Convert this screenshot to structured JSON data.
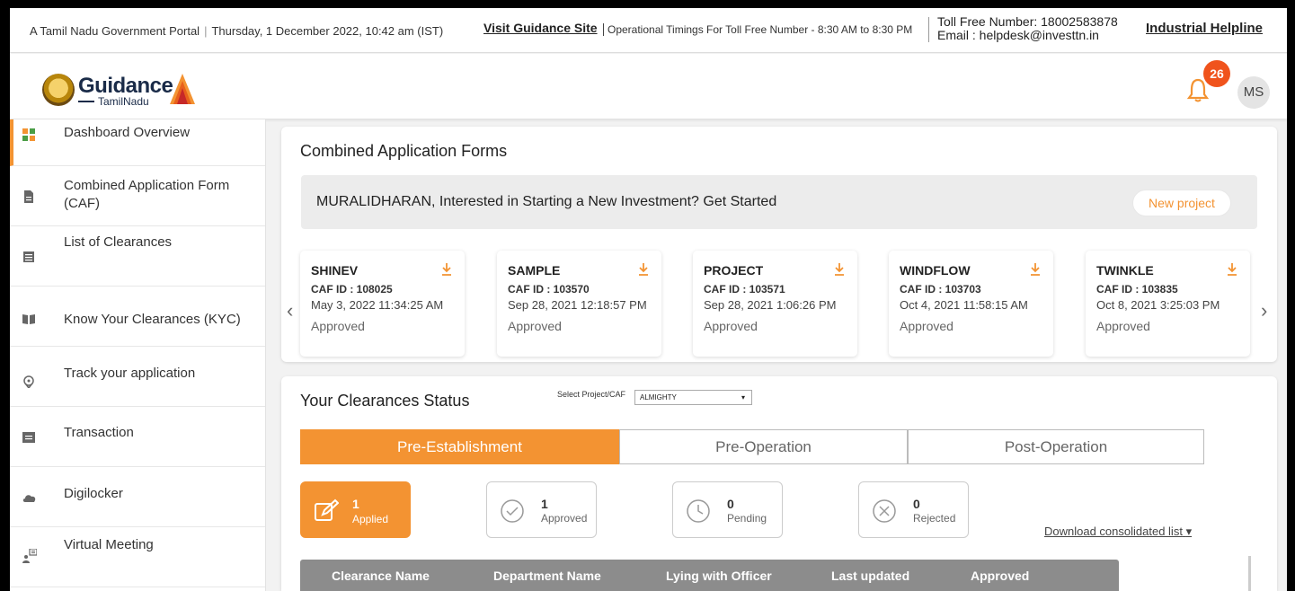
{
  "topbar": {
    "portal": "A Tamil Nadu Government Portal",
    "datetime": "Thursday, 1 December 2022, 10:42 am (IST)",
    "visit_link": "Visit Guidance Site",
    "timings": "Operational Timings For Toll Free Number - 8:30 AM to 8:30 PM",
    "toll_free": "Toll Free Number: 18002583878",
    "email": "Email : helpdesk@investtn.in",
    "helpline": "Industrial Helpline"
  },
  "header": {
    "logo_word": "Guidance",
    "logo_sub": "TamilNadu",
    "notification_count": "26",
    "avatar_initials": "MS"
  },
  "sidebar": {
    "items": [
      {
        "label": "Dashboard Overview",
        "icon": "dashboard-grid-icon"
      },
      {
        "label": "Combined Application Form (CAF)",
        "icon": "document-icon"
      },
      {
        "label": "List of Clearances",
        "icon": "list-icon"
      },
      {
        "label": "Know Your Clearances (KYC)",
        "icon": "book-icon"
      },
      {
        "label": "Track your application",
        "icon": "location-pin-icon"
      },
      {
        "label": "Transaction",
        "icon": "transaction-icon"
      },
      {
        "label": "Digilocker",
        "icon": "cloud-icon"
      },
      {
        "label": "Virtual Meeting",
        "icon": "meeting-icon"
      }
    ]
  },
  "caf": {
    "title": "Combined Application Forms",
    "banner_text": "MURALIDHARAN, Interested in Starting a New Investment? Get Started",
    "new_project": "New project",
    "prev_arrow": "‹",
    "next_arrow": "›",
    "projects": [
      {
        "name": "SHINEV",
        "caf_id": "CAF ID : 108025",
        "date": "May 3, 2022 11:34:25 AM",
        "status": "Approved"
      },
      {
        "name": "SAMPLE",
        "caf_id": "CAF ID : 103570",
        "date": "Sep 28, 2021 12:18:57 PM",
        "status": "Approved"
      },
      {
        "name": "PROJECT",
        "caf_id": "CAF ID : 103571",
        "date": "Sep 28, 2021 1:06:26 PM",
        "status": "Approved"
      },
      {
        "name": "WINDFLOW",
        "caf_id": "CAF ID : 103703",
        "date": "Oct 4, 2021 11:58:15 AM",
        "status": "Approved"
      },
      {
        "name": "TWINKLE",
        "caf_id": "CAF ID : 103835",
        "date": "Oct 8, 2021 3:25:03 PM",
        "status": "Approved"
      }
    ]
  },
  "clearances": {
    "title": "Your Clearances Status",
    "select_label": "Select Project/CAF",
    "select_value": "ALMIGHTY",
    "tabs": [
      "Pre-Establishment",
      "Pre-Operation",
      "Post-Operation"
    ],
    "stats": [
      {
        "count": "1",
        "label": "Applied",
        "icon": "edit-icon"
      },
      {
        "count": "1",
        "label": "Approved",
        "icon": "check-circle-icon"
      },
      {
        "count": "0",
        "label": "Pending",
        "icon": "clock-icon"
      },
      {
        "count": "0",
        "label": "Rejected",
        "icon": "x-circle-icon"
      }
    ],
    "download_link": "Download consolidated list",
    "table_headers": [
      "Clearance Name",
      "Department Name",
      "Lying with Officer",
      "Last updated",
      "Approved"
    ]
  },
  "colors": {
    "accent": "#f39332",
    "badge": "#f0531c",
    "table_header": "#8c8c8c"
  }
}
